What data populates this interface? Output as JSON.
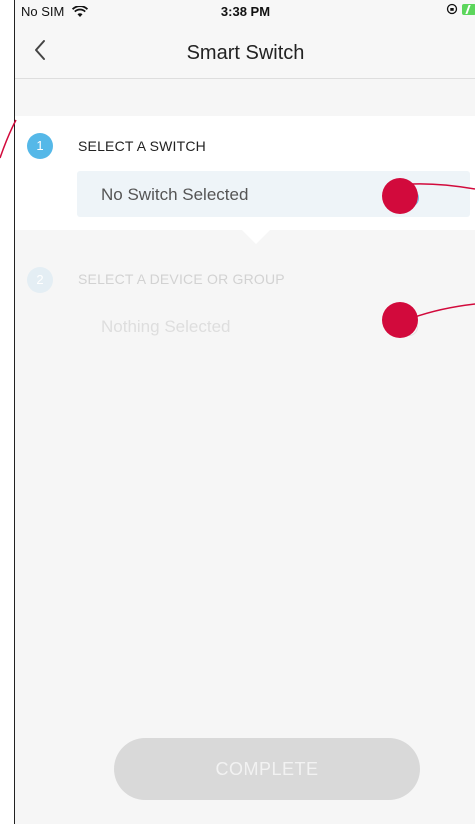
{
  "status_bar": {
    "carrier": "No SIM",
    "time": "3:38 PM",
    "icons": [
      "wifi-icon",
      "orientation-lock-icon",
      "battery-charging-icon"
    ]
  },
  "nav": {
    "title": "Smart Switch",
    "back_icon": "chevron-left-icon"
  },
  "steps": [
    {
      "number": "1",
      "title": "SELECT A SWITCH",
      "value": "No Switch Selected",
      "action_icon": "plus-circle-icon",
      "enabled": true
    },
    {
      "number": "2",
      "title": "SELECT A DEVICE OR GROUP",
      "value": "Nothing Selected",
      "action_icon": "plus-circle-icon",
      "enabled": false
    }
  ],
  "complete_button": {
    "label": "COMPLETE",
    "enabled": false
  },
  "colors": {
    "accent": "#55b8e8",
    "annotation": "#d20a3c",
    "disabled_button": "#d9d9d9"
  }
}
